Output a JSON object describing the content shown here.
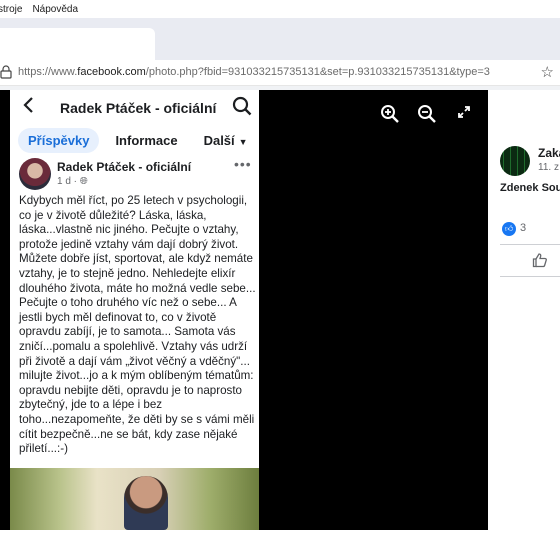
{
  "menubar": {
    "items": [
      "stroje",
      "Nápověda"
    ]
  },
  "address_bar": {
    "url_prefix": "https://www.",
    "url_host": "facebook.com",
    "url_rest": "/photo.php?fbid=931033215735131&set=p.931033215735131&type=3"
  },
  "icons": {
    "lock": "lock-icon",
    "star": "bookmark-star-icon",
    "zoom_in": "zoom-in-icon",
    "zoom_out": "zoom-out-icon",
    "expand": "fullscreen-icon"
  },
  "phone": {
    "header_title": "Radek Ptáček - oficiální",
    "tabs": [
      {
        "label": "Příspěvky",
        "active": true
      },
      {
        "label": "Informace",
        "active": false
      },
      {
        "label": "Další",
        "active": false
      }
    ],
    "post": {
      "author": "Radek Ptáček - oficiální",
      "meta": "1 d ·",
      "body": "Kdybych měl říct, po 25 letech v psychologii, co je v životě důležité? Láska, láska, láska...vlastně nic jiného. Pečujte o vztahy, protože jedině vztahy vám dají dobrý život. Můžete dobře jíst, sportovat, ale když nemáte vztahy, je to stejně jedno. Nehledejte elixír dlouhého života, máte ho možná vedle sebe... Pečujte o toho druhého víc než o sebe... A jestli bych měl definovat to, co v životě opravdu zabíjí, je to samota... Samota vás zničí...pomalu a spolehlivě. Vztahy vás udrží při životě a dají vám „život věčný a vděčný\"... milujte život...jo a k mým oblíbeným tématům: opravdu nebijte děti, opravdu je to naprosto zbytečný, jde to a lépe i bez toho...nezapomeňte, že děti by se s vámi měli cítit bezpečně...ne se bát, kdy zase nějaké přiletí...:-)"
    }
  },
  "comment_panel": {
    "name": "Zaká",
    "date": "11. z",
    "text": "Zdenek Sou",
    "like_count": "3"
  }
}
